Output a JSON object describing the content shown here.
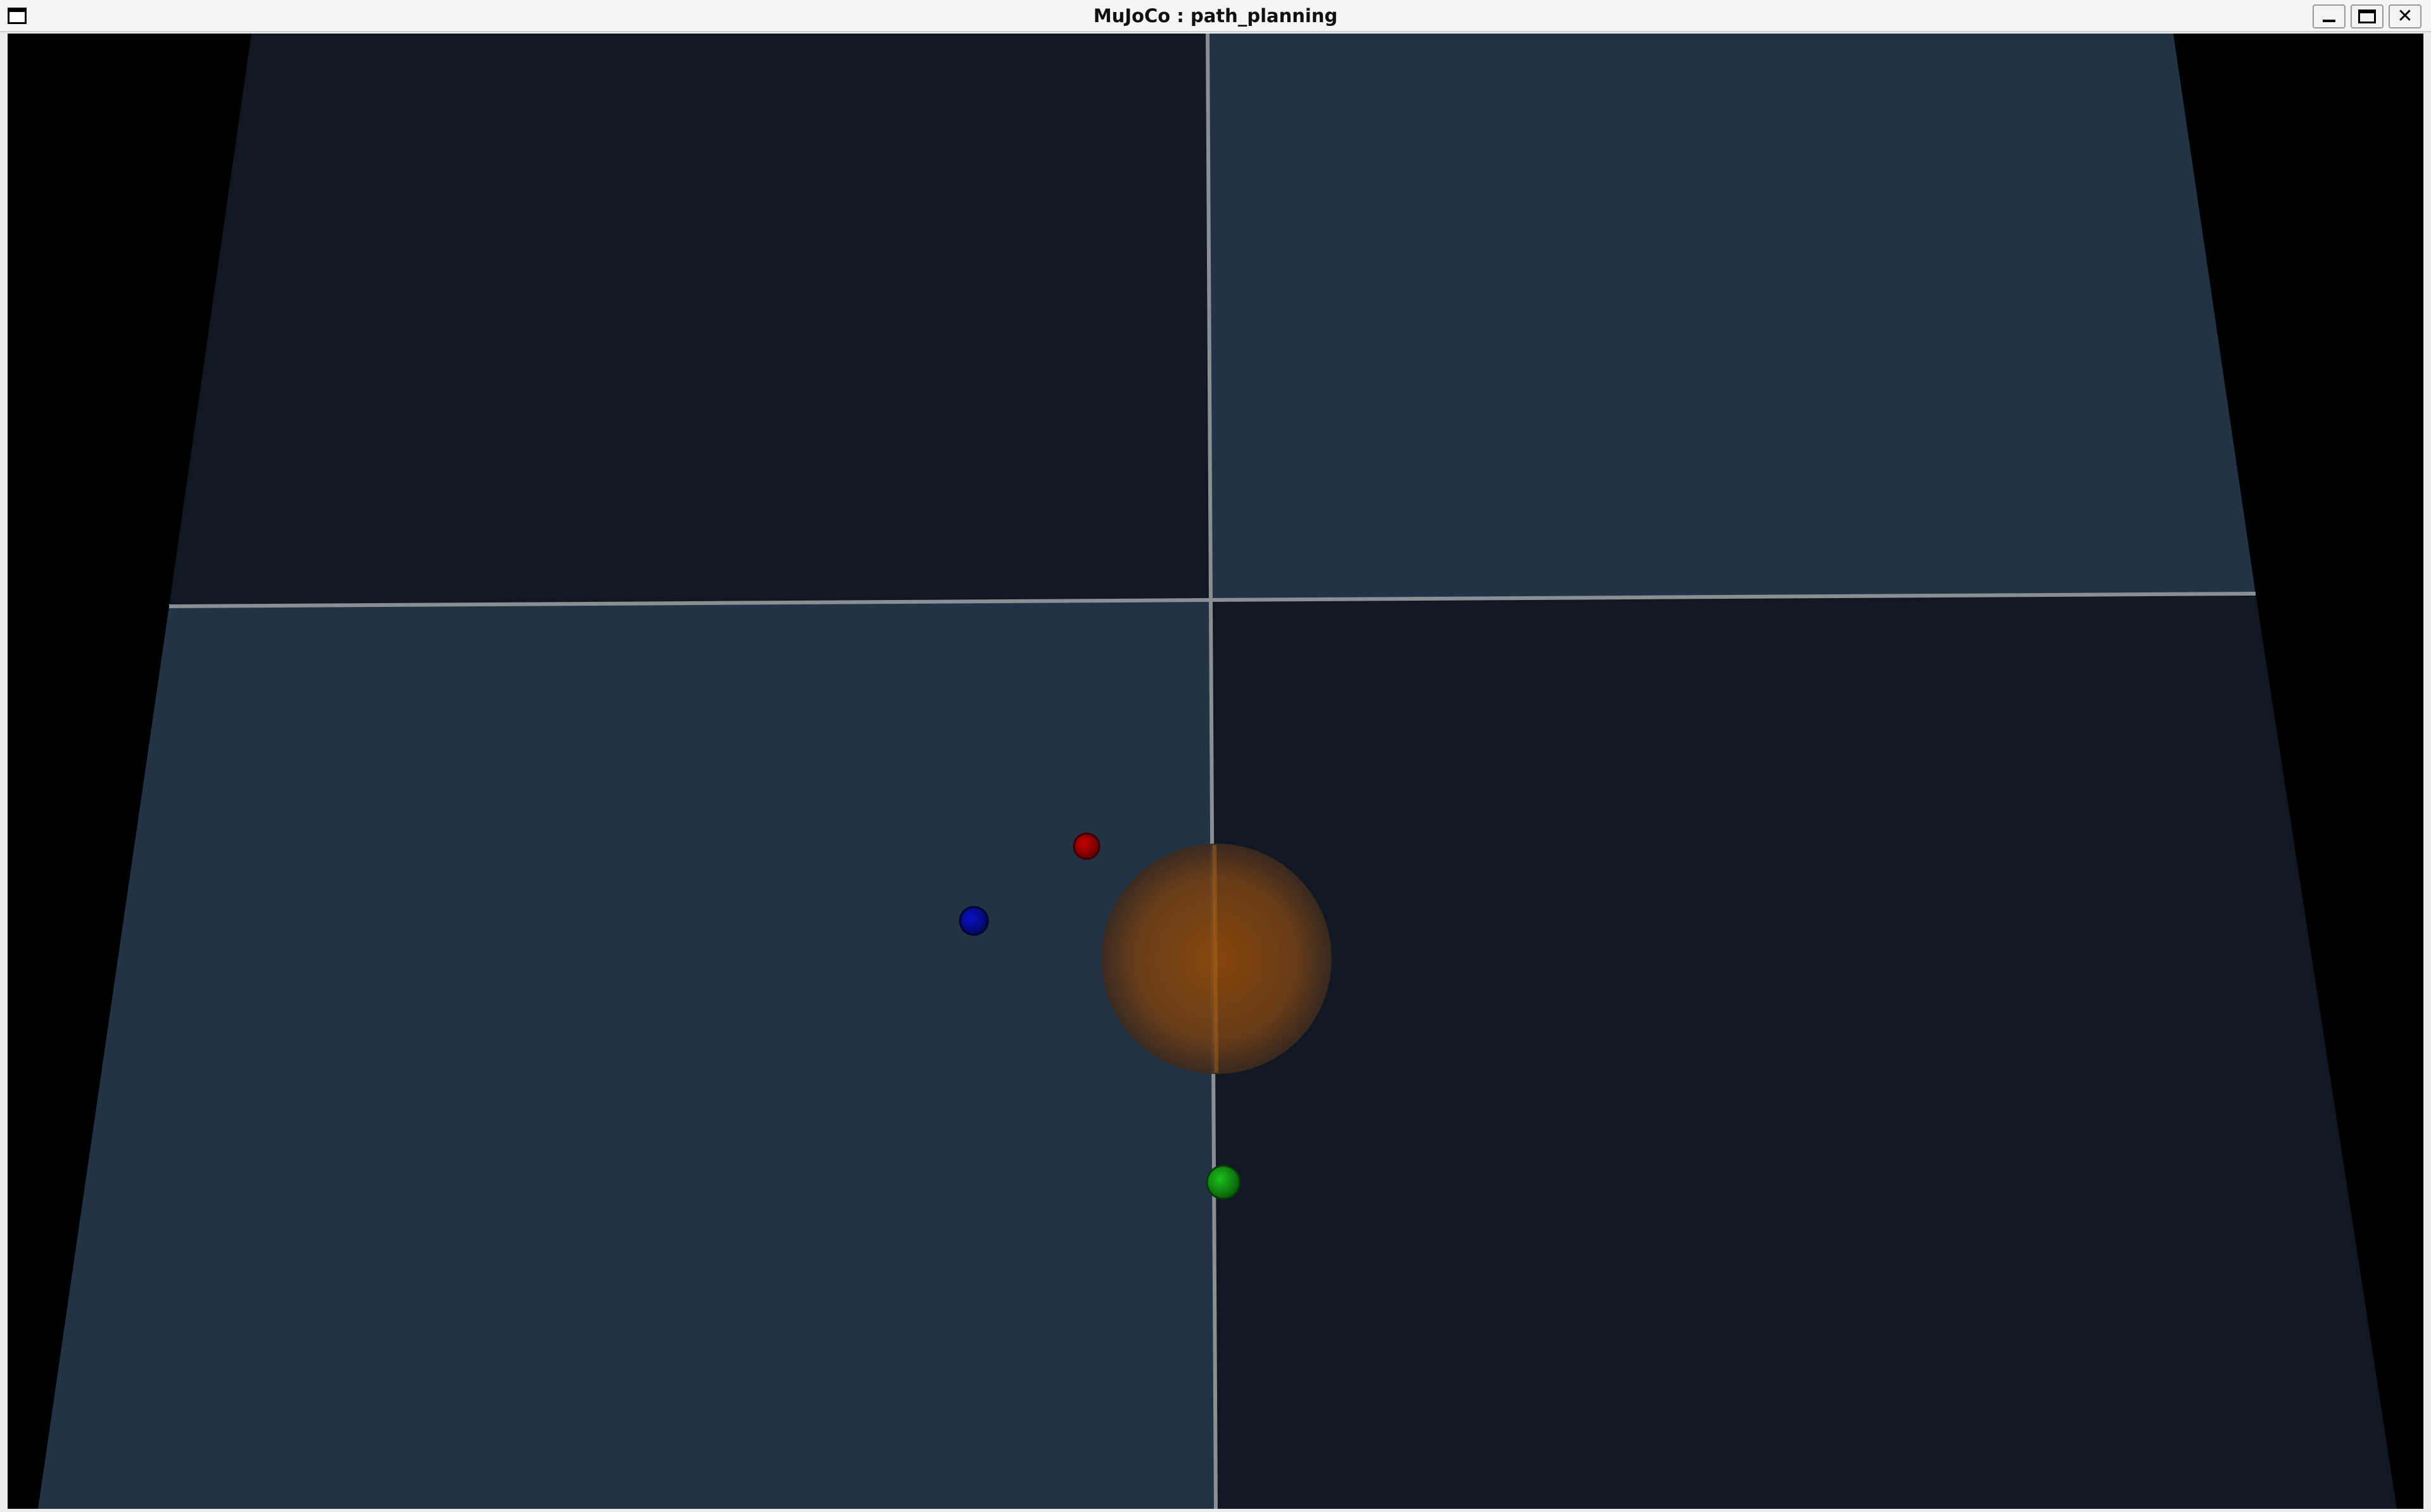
{
  "window": {
    "title": "MuJoCo : path_planning"
  },
  "titlebar_buttons": {
    "minimize_icon": "minimize-icon",
    "maximize_icon": "maximize-icon",
    "close_icon": "close-icon",
    "close_glyph": "✕"
  },
  "scene": {
    "background_color": "#000000",
    "tile_light_color": "#223346",
    "tile_dark_color": "#111821",
    "grid_line_color": "#8a8f94",
    "obstacle_color": "#8a4a0c",
    "markers": [
      {
        "name": "red-marker",
        "color": "#b10000"
      },
      {
        "name": "blue-marker",
        "color": "#0a0fb0"
      },
      {
        "name": "green-marker",
        "color": "#12a012"
      }
    ]
  }
}
